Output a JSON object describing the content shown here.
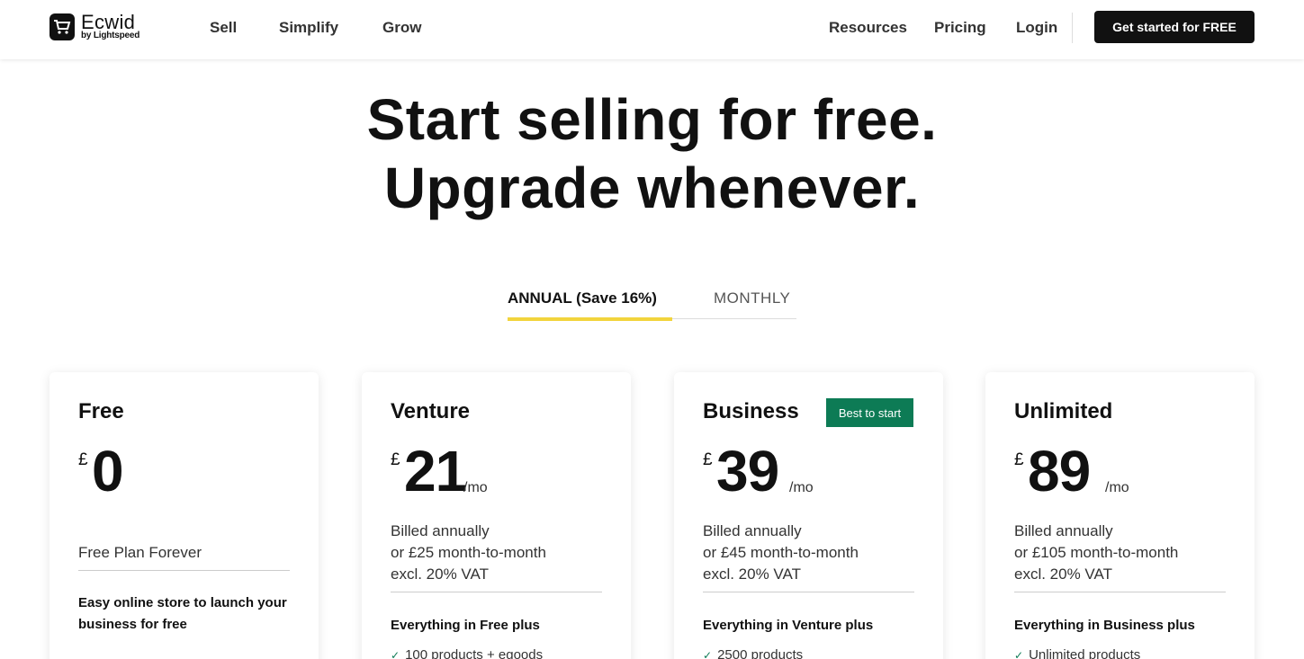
{
  "header": {
    "logo_name": "Ecwid",
    "logo_sub": "by Lightspeed",
    "nav_left": [
      "Sell",
      "Simplify",
      "Grow"
    ],
    "nav_right": [
      "Resources",
      "Pricing",
      "Login"
    ],
    "cta_label": "Get started for FREE"
  },
  "hero": {
    "line1": "Start selling for free.",
    "line2": "Upgrade whenever."
  },
  "billing_toggle": {
    "annual_label": "ANNUAL (Save 16%)",
    "monthly_label": "MONTHLY",
    "active": "annual",
    "accent_color": "#f2d43d"
  },
  "plans": [
    {
      "name": "Free",
      "currency": "£",
      "price": "0",
      "per": "",
      "subtitle": "Free Plan Forever",
      "description": "Easy online store to launch your business for free"
    },
    {
      "name": "Venture",
      "currency": "£",
      "price": "21",
      "per": "/mo",
      "billing_line1": "Billed annually",
      "billing_line2": "or £25 month-to-month",
      "billing_line3": "excl. 20% VAT",
      "feature_head": "Everything in Free plus",
      "first_feature": "100 products + egoods"
    },
    {
      "name": "Business",
      "badge": "Best to start",
      "badge_color": "#0d7b55",
      "currency": "£",
      "price": "39",
      "per": "/mo",
      "billing_line1": "Billed annually",
      "billing_line2": "or £45 month-to-month",
      "billing_line3": "excl. 20% VAT",
      "feature_head": "Everything in Venture plus",
      "first_feature": "2500 products"
    },
    {
      "name": "Unlimited",
      "currency": "£",
      "price": "89",
      "per": "/mo",
      "billing_line1": "Billed annually",
      "billing_line2": "or £105 month-to-month",
      "billing_line3": "excl. 20% VAT",
      "feature_head": "Everything in Business plus",
      "first_feature": "Unlimited products"
    }
  ]
}
